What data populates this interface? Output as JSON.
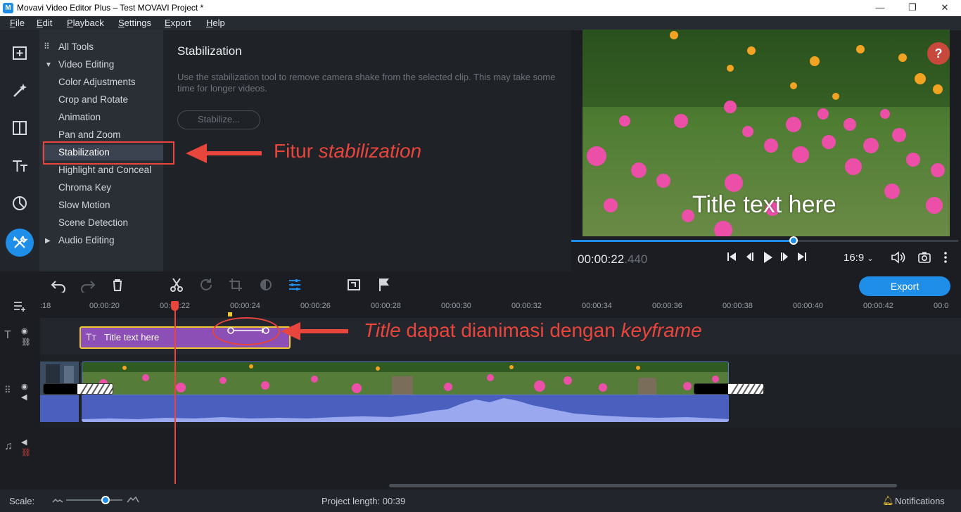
{
  "window": {
    "title": "Movavi Video Editor Plus – Test MOVAVI Project *",
    "minimize": "—",
    "maximize": "❐",
    "close": "✕"
  },
  "menu": [
    "File",
    "Edit",
    "Playback",
    "Settings",
    "Export",
    "Help"
  ],
  "rail": {
    "icons": [
      "import-icon",
      "magic-wand-icon",
      "transitions-icon",
      "titles-icon",
      "stickers-icon",
      "tools-icon"
    ],
    "active": "tools-icon"
  },
  "tools": {
    "all_tools": "All Tools",
    "video_editing": "Video Editing",
    "items": [
      "Color Adjustments",
      "Crop and Rotate",
      "Animation",
      "Pan and Zoom",
      "Stabilization",
      "Highlight and Conceal",
      "Chroma Key",
      "Slow Motion",
      "Scene Detection"
    ],
    "selected": "Stabilization",
    "audio_editing": "Audio Editing"
  },
  "panel": {
    "title": "Stabilization",
    "description": "Use the stabilization tool to remove camera shake from the selected clip. This may take some time for longer videos.",
    "button": "Stabilize..."
  },
  "preview": {
    "help": "?",
    "overlay_title": "Title text here",
    "timecode_main": "00:00:22",
    "timecode_ms": ".440",
    "aspect_ratio": "16:9",
    "playback_progress": 0.57
  },
  "toolbar": {
    "export": "Export"
  },
  "timeline": {
    "ticks": [
      ":18",
      "00:00:20",
      "00:00:22",
      "00:00:24",
      "00:00:26",
      "00:00:28",
      "00:00:30",
      "00:00:32",
      "00:00:34",
      "00:00:36",
      "00:00:38",
      "00:00:40",
      "00:00:42",
      "00:0"
    ],
    "title_clip": "Title text here"
  },
  "annotations": {
    "fitur_plain": "Fitur ",
    "fitur_italic": "stabilization",
    "title_italic": "Title",
    "title_plain": " dapat dianimasi dengan ",
    "keyframe_italic": "keyframe"
  },
  "status": {
    "scale_label": "Scale:",
    "project_length_label": "Project length:",
    "project_length_value": "00:39",
    "notifications": "Notifications"
  },
  "colors": {
    "accent": "#1f8ee8",
    "annotation": "#e8453c",
    "title_clip": "#8b4fb5",
    "selection": "#f0c832"
  }
}
